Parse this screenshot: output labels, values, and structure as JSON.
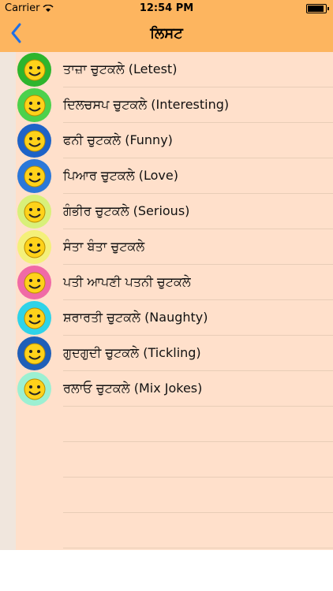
{
  "status": {
    "carrier": "Carrier",
    "time": "12:54 PM"
  },
  "nav": {
    "back_icon": "chevron-left-icon",
    "title": "ਲਿਸਟ"
  },
  "items": [
    {
      "label": "ਤਾਜ਼ਾ ਚੁਟਕਲੇ (Letest)",
      "icon": "laughing-face-icon",
      "color": "#2db52d"
    },
    {
      "label": "ਦਿਲਚਸਪ ਚੁਟਕਲੇ (Interesting)",
      "icon": "thinking-face-icon",
      "color": "#4cd14c"
    },
    {
      "label": "ਫਨੀ ਚੁਟਕਲੇ (Funny)",
      "icon": "cartoon-dog-icon",
      "color": "#1e63c7"
    },
    {
      "label": "ਪਿਆਰ ਚੁਟਕਲੇ (Love)",
      "icon": "love-face-icon",
      "color": "#2b78d9"
    },
    {
      "label": "ਗੰਭੀਰ ਚੁਟਕਲੇ (Serious)",
      "icon": "serious-face-icon",
      "color": "#d8f07a"
    },
    {
      "label": "ਸੰਤਾ ਬੰਤਾ ਚੁਟਕਲੇ",
      "icon": "santa-banta-icon",
      "color": "#f4f07a"
    },
    {
      "label": "ਪਤੀ ਆਪਣੀ ਪਤਨੀ ਚੁਟਕਲੇ",
      "icon": "couple-icon",
      "color": "#f06aa6"
    },
    {
      "label": "ਸ਼ਰਾਰਤੀ ਚੁਟਕਲੇ (Naughty)",
      "icon": "naughty-kid-icon",
      "color": "#2fd3e8"
    },
    {
      "label": "ਗੁਦਗੁਦੀ ਚੁਟਕਲੇ (Tickling)",
      "icon": "tickling-icon",
      "color": "#1f5fb8"
    },
    {
      "label": "ਰਲਾਓ ਚੁਟਕਲੇ (Mix Jokes)",
      "icon": "smiley-face-icon",
      "color": "#9cf0d2"
    }
  ]
}
